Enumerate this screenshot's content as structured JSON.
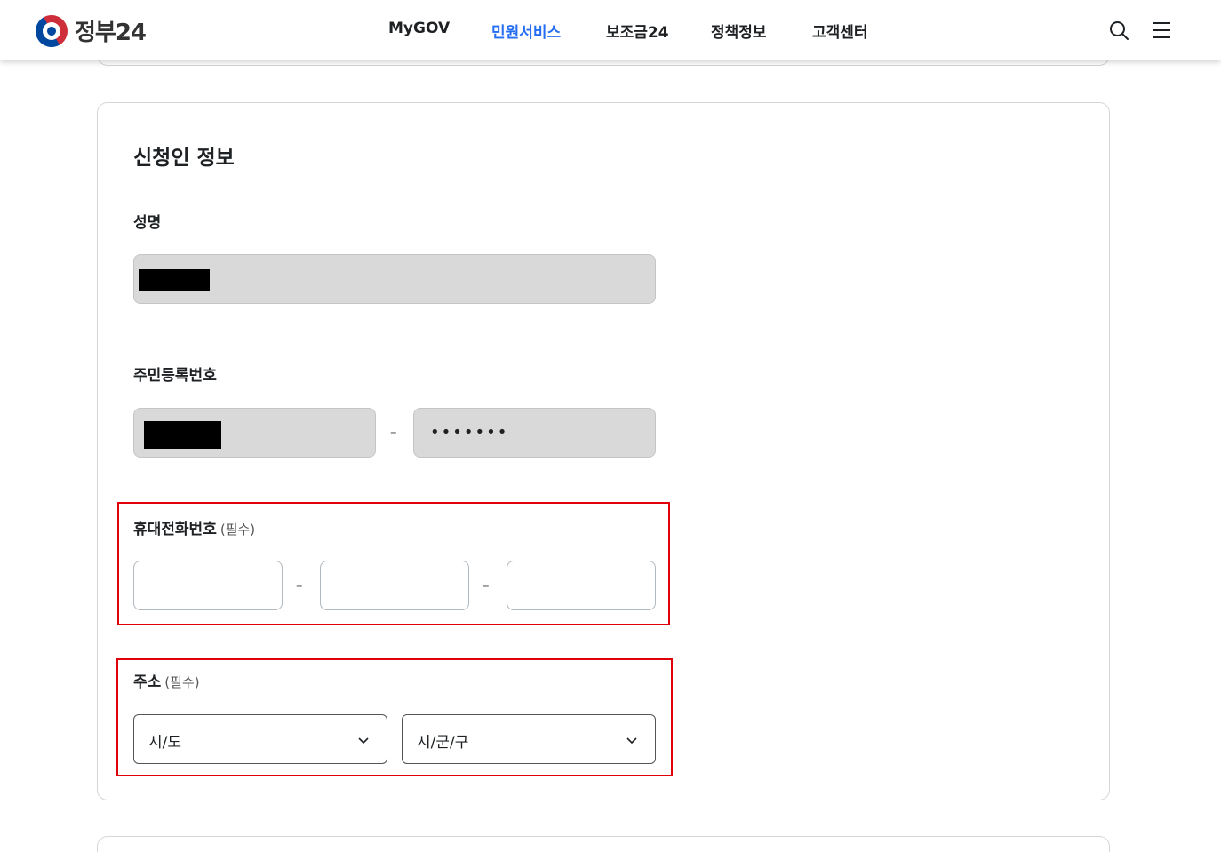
{
  "header": {
    "logo_text": "정부24",
    "nav": [
      "MyGOV",
      "민원서비스",
      "보조금24",
      "정책정보",
      "고객센터"
    ],
    "active_nav": "민원서비스",
    "icons": [
      "search-icon",
      "menu-icon"
    ]
  },
  "form": {
    "section_title": "신청인 정보",
    "name": {
      "label": "성명",
      "value_redacted": true
    },
    "rrn": {
      "label": "주민등록번호",
      "front_redacted": true,
      "back_masked": "•••••••",
      "separator": "–"
    },
    "phone": {
      "label": "휴대전화번호",
      "required": "(필수)",
      "separator": "–"
    },
    "address": {
      "label": "주소",
      "required": "(필수)",
      "sido_placeholder": "시/도",
      "sigungu_placeholder": "시/군/구"
    }
  },
  "colors": {
    "accent": "#256ef4",
    "highlight": "#e0000a",
    "disabled_bg": "#d9d9d9"
  }
}
